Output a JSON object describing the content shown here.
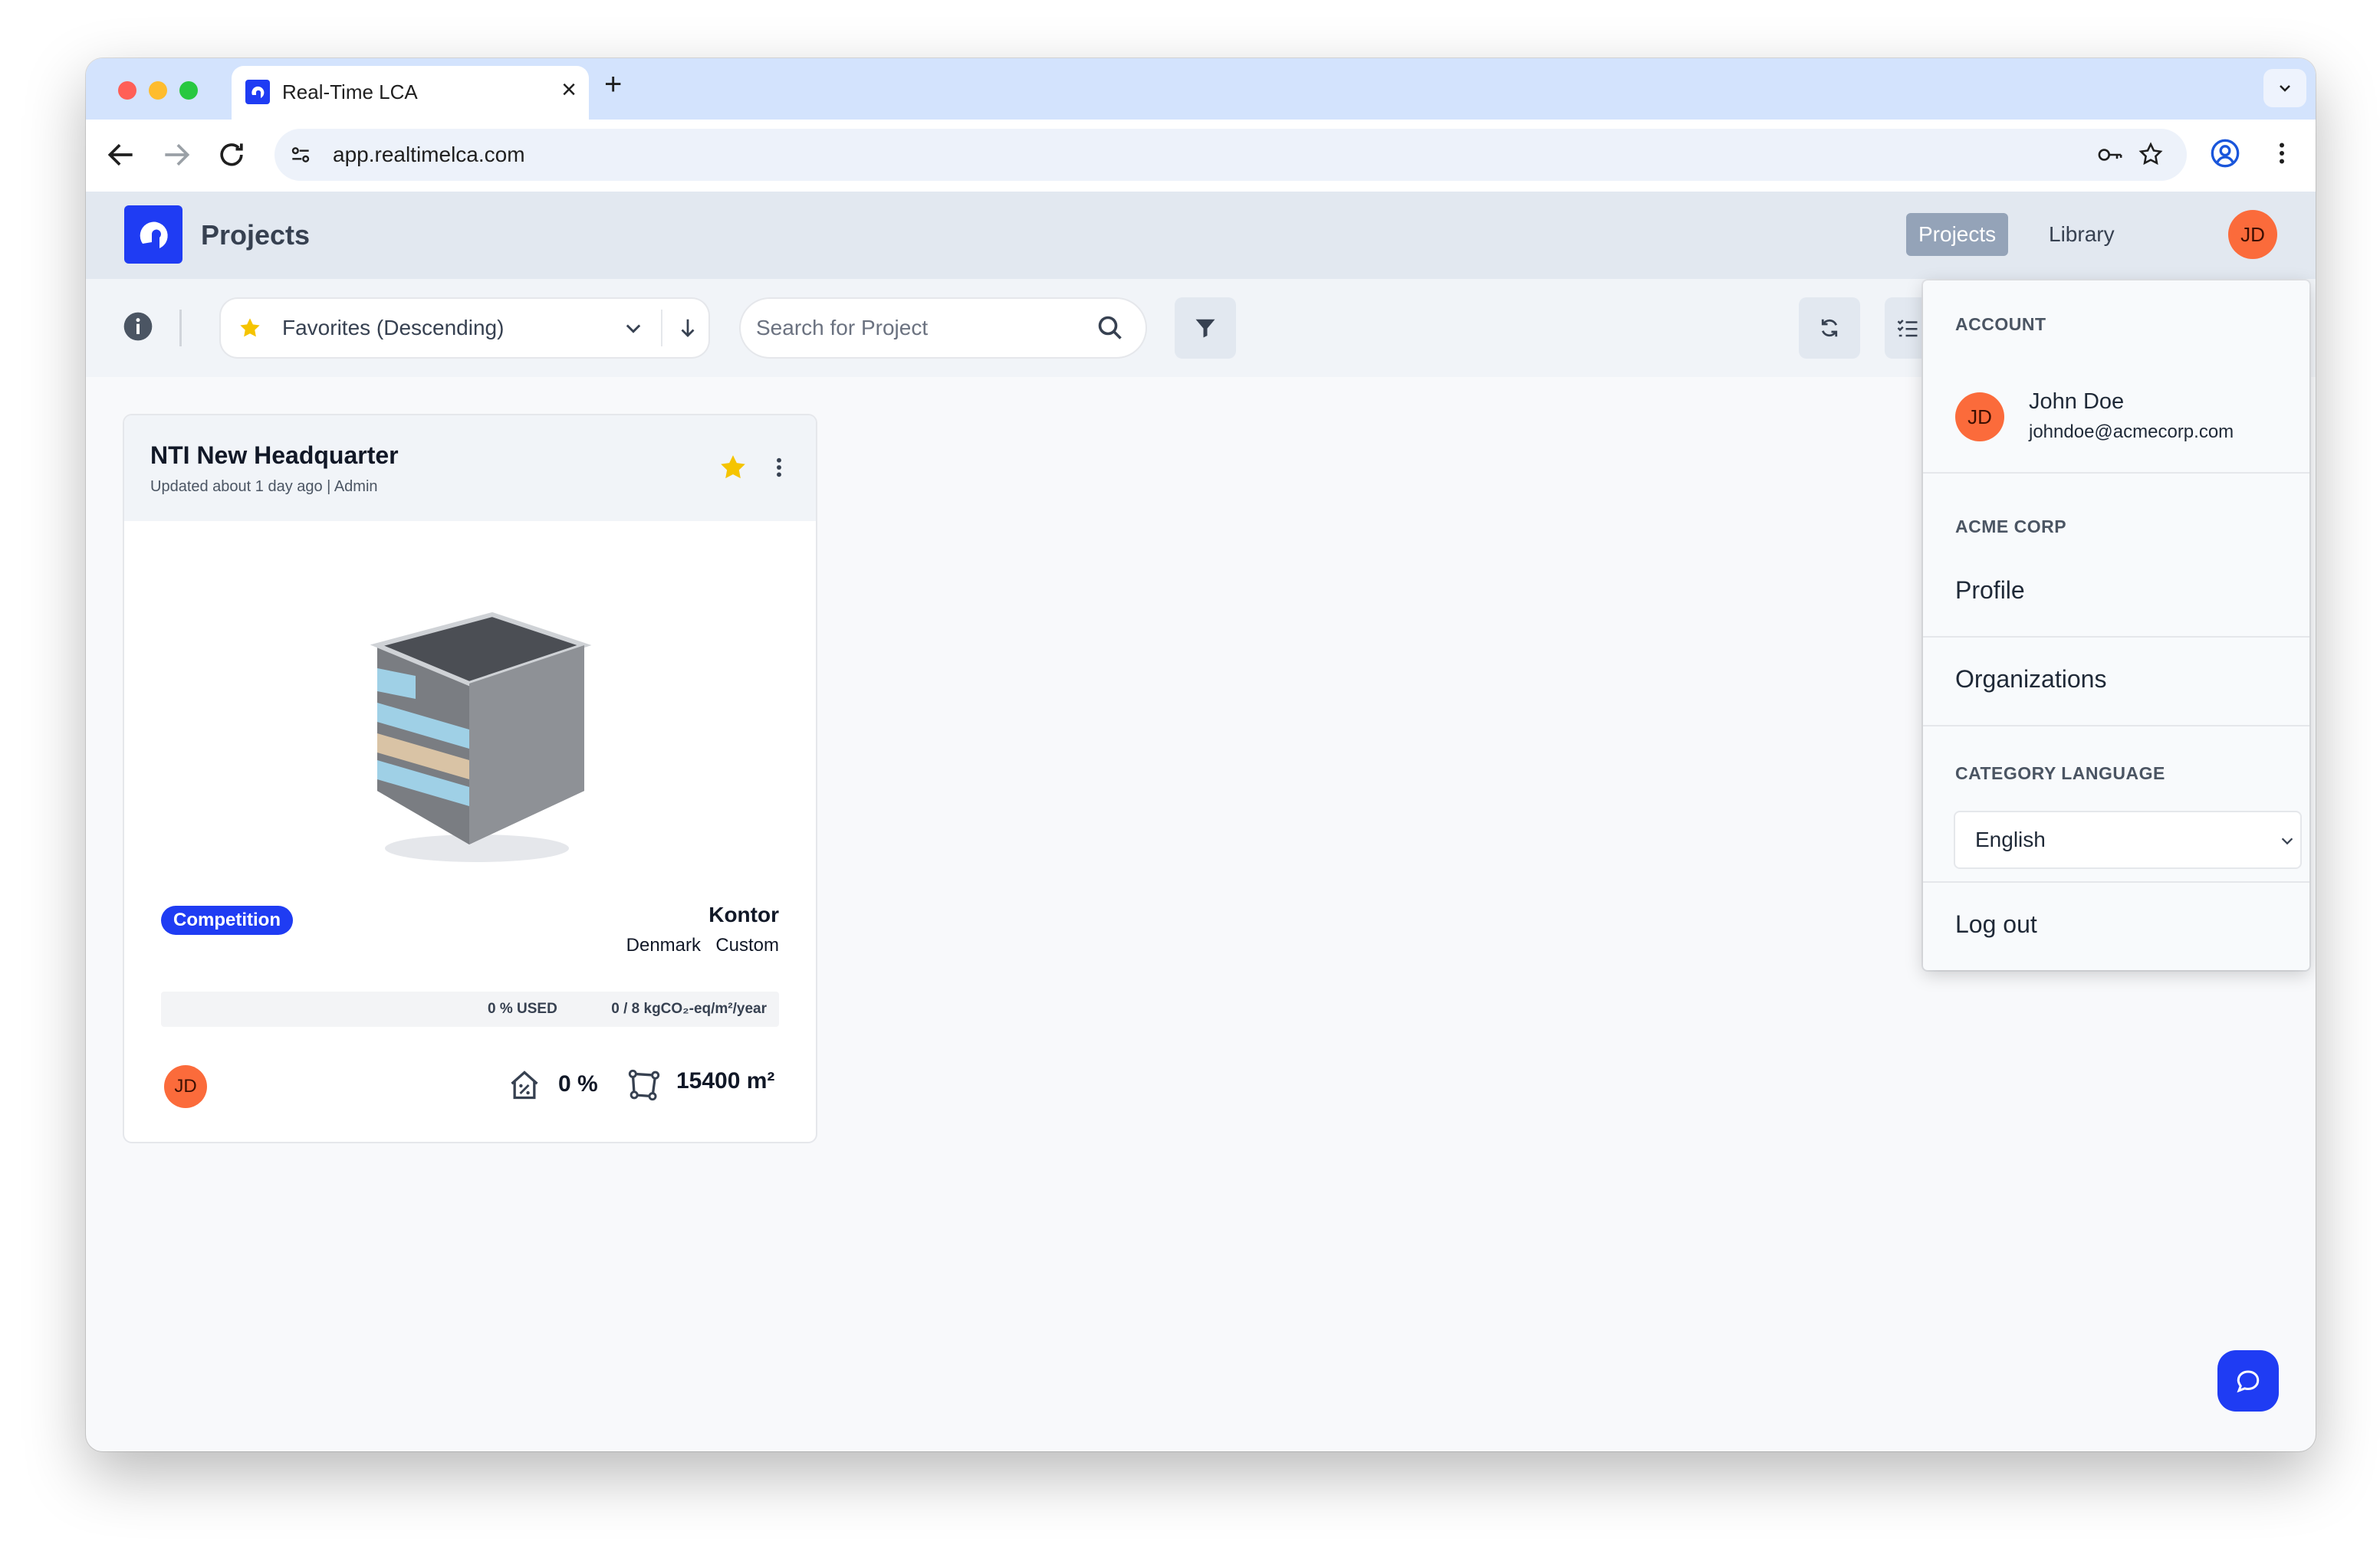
{
  "browser": {
    "tab_title": "Real-Time LCA",
    "url": "app.realtimelca.com"
  },
  "app": {
    "title": "Projects",
    "nav": {
      "projects": "Projects",
      "library": "Library"
    },
    "avatar_initials": "JD"
  },
  "filters": {
    "sort_label": "Favorites (Descending)",
    "search_placeholder": "Search for Project"
  },
  "project": {
    "title": "NTI New Headquarter",
    "subtitle": "Updated about 1 day ago | Admin",
    "badge": "Competition",
    "type": "Kontor",
    "country": "Denmark",
    "method": "Custom",
    "used_label": "0 % USED",
    "target_label": "0 / 8 kgCO₂-eq/m²/year",
    "owner_initials": "JD",
    "percent": "0 %",
    "area": "15400 m²"
  },
  "user_menu": {
    "account_label": "ACCOUNT",
    "user_name": "John Doe",
    "user_email": "johndoe@acmecorp.com",
    "avatar_initials": "JD",
    "org_label": "ACME CORP",
    "profile": "Profile",
    "organizations": "Organizations",
    "language_label": "CATEGORY LANGUAGE",
    "language_value": "English",
    "logout": "Log out"
  },
  "colors": {
    "brand": "#1f3cf3",
    "avatar": "#fb6b3b",
    "star": "#f5c400"
  }
}
